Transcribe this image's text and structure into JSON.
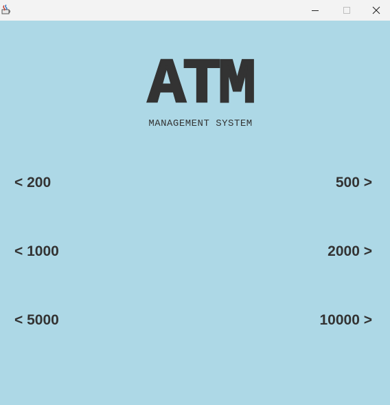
{
  "window": {
    "icon": "java-cup-icon",
    "controls": {
      "minimize_glyph": "–",
      "maximize_glyph": "□",
      "close_glyph": "✕"
    }
  },
  "logo": {
    "title": "ATM",
    "subtitle": "MANAGEMENT SYSTEM"
  },
  "amounts": {
    "left": [
      "< 200",
      "< 1000",
      "< 5000"
    ],
    "right": [
      "500 >",
      "2000 >",
      "10000 >"
    ]
  },
  "colors": {
    "background": "#add8e6",
    "text": "#333333",
    "titlebar": "#f3f3f3"
  }
}
